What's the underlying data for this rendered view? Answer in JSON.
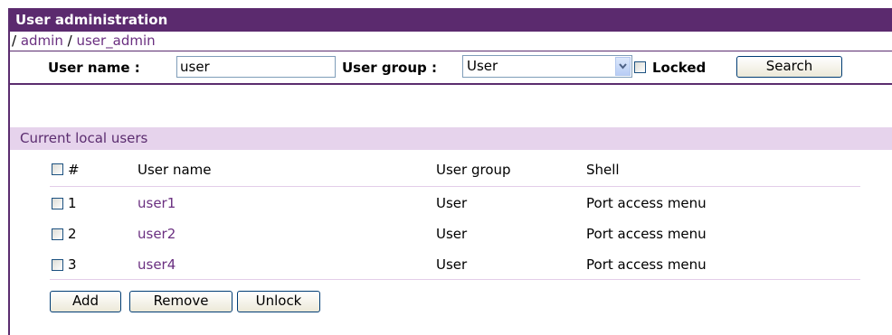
{
  "header": {
    "title": "User administration"
  },
  "breadcrumb": {
    "sep1": "/",
    "admin": "admin",
    "sep2": "/",
    "user_admin": "user_admin"
  },
  "search": {
    "username_label": "User name :",
    "username_value": "user",
    "usergroup_label": "User group :",
    "usergroup_selected": "User",
    "locked_label": "Locked",
    "search_button": "Search"
  },
  "users": {
    "section_title": "Current local users",
    "columns": {
      "num": "#",
      "username": "User name",
      "usergroup": "User group",
      "shell": "Shell"
    },
    "rows": [
      {
        "num": "1",
        "username": "user1",
        "usergroup": "User",
        "shell": "Port access menu"
      },
      {
        "num": "2",
        "username": "user2",
        "usergroup": "User",
        "shell": "Port access menu"
      },
      {
        "num": "3",
        "username": "user4",
        "usergroup": "User",
        "shell": "Port access menu"
      }
    ]
  },
  "actions": {
    "add": "Add",
    "remove": "Remove",
    "unlock": "Unlock"
  },
  "colors": {
    "accent": "#5b2a6e",
    "section_bg": "#e6d3ec",
    "link": "#6a2f80"
  }
}
